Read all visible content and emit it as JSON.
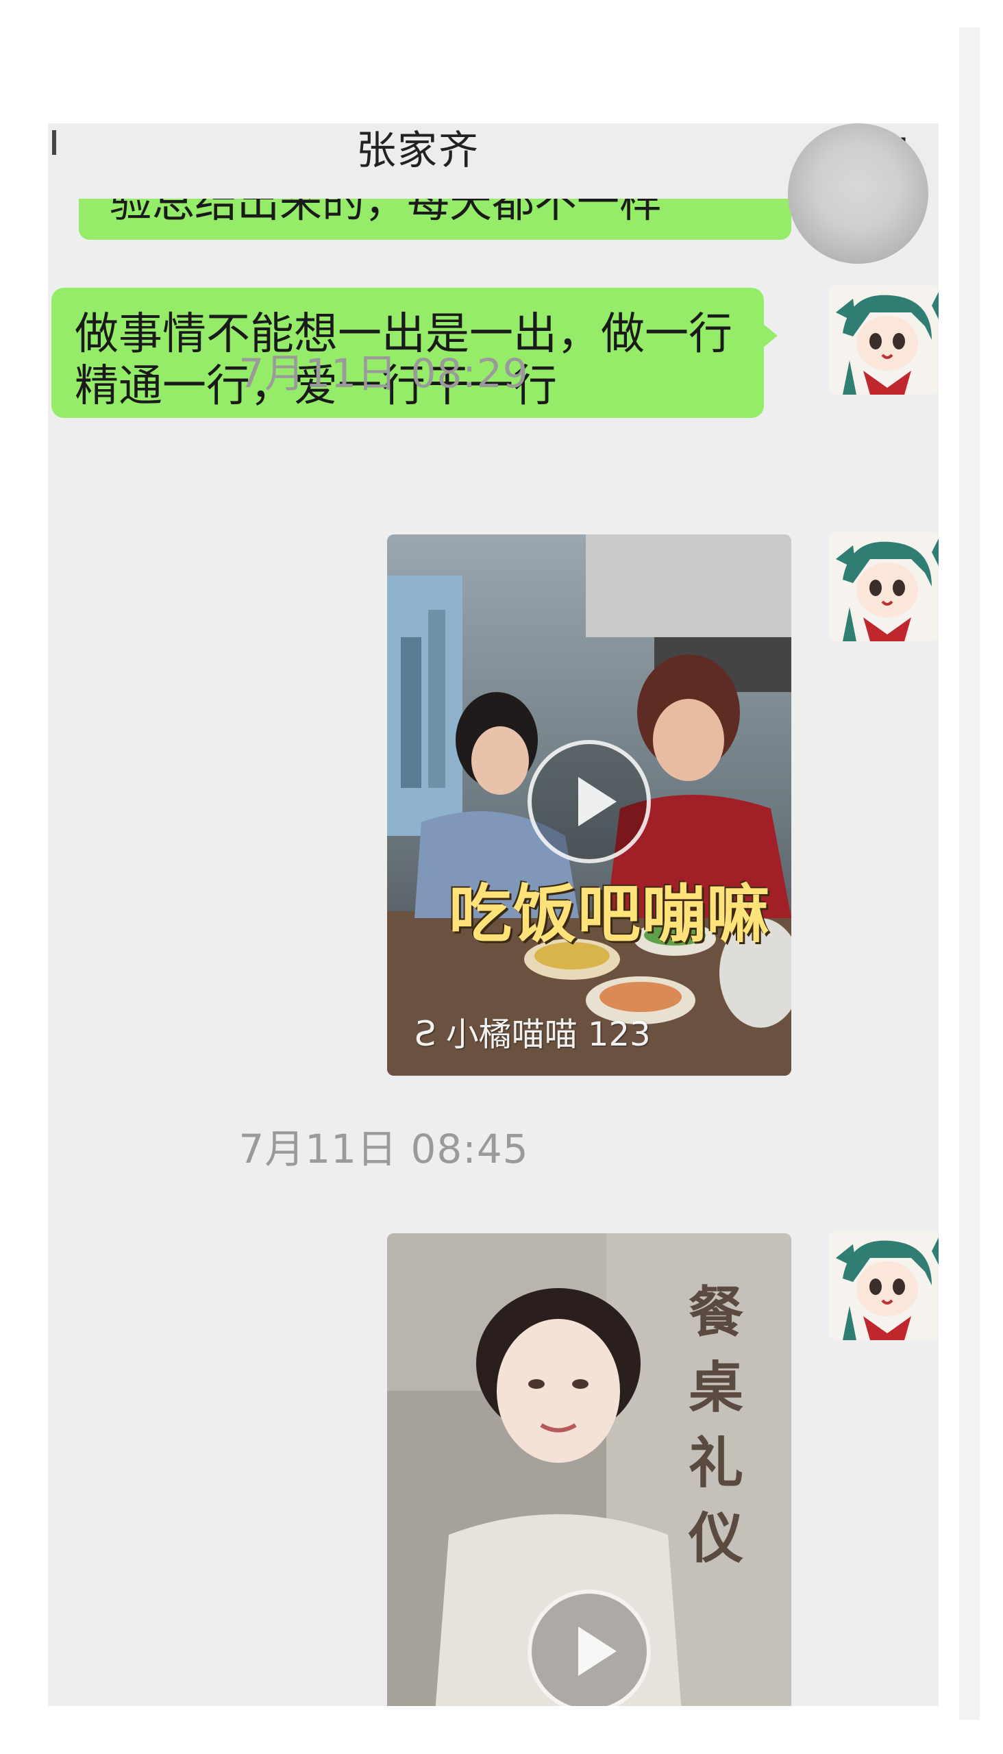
{
  "header": {
    "title": "张家齐",
    "more_icon": "···"
  },
  "messages": {
    "partial_bubble": "验总结出来的，每天都不一样",
    "bubble_main": "做事情不能想一出是一出，做一行精通一行，爱一行干一行"
  },
  "timestamps": [
    "7月11日 08:29",
    "7月11日 08:45"
  ],
  "video1": {
    "caption": "吃饭吧嘣嘛",
    "watermark": "小橘喵喵 123",
    "watermark_icon": "butterfly-logo-icon"
  },
  "video2": {
    "caption": "餐桌礼仪"
  },
  "colors": {
    "bubble_green": "#95ec69",
    "timestamp_gray": "#9a9a9a",
    "background": "#eeeeee"
  }
}
